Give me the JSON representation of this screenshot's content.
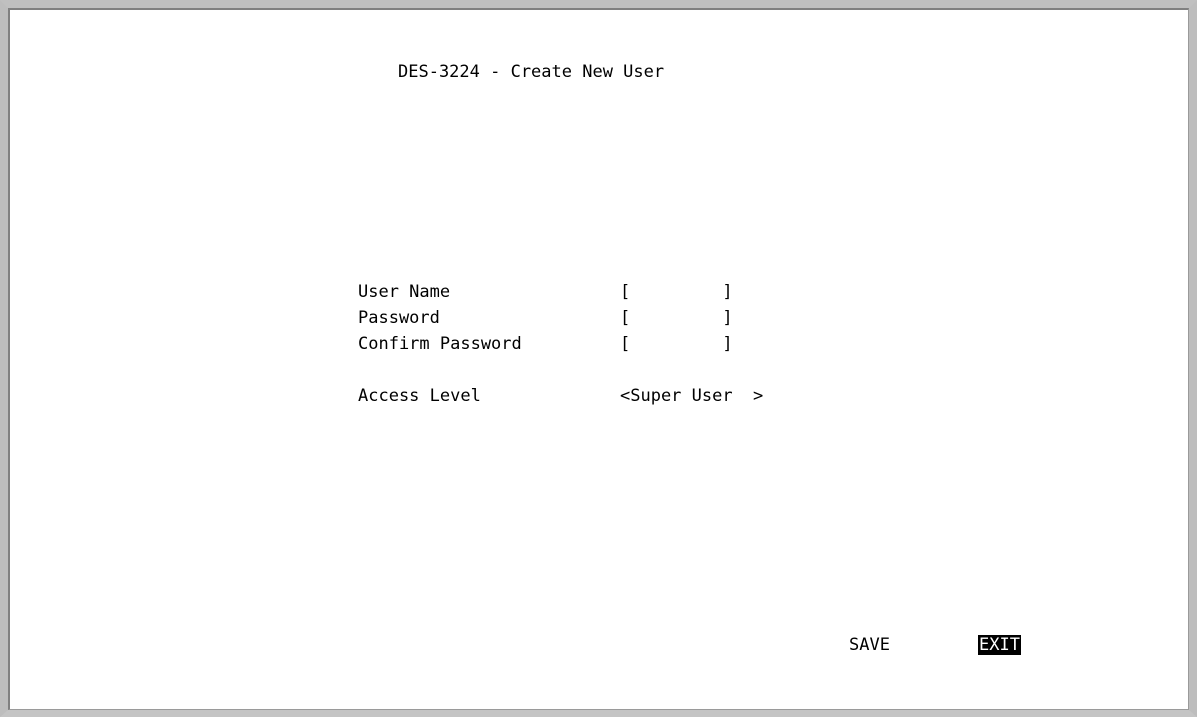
{
  "screen": {
    "title": "DES-3224 - Create New User"
  },
  "form": {
    "user_name": {
      "label": "User Name",
      "value": "[         ]"
    },
    "password": {
      "label": "Password",
      "value": "[         ]"
    },
    "confirm_password": {
      "label": "Confirm Password",
      "value": "[         ]"
    },
    "access_level": {
      "label": "Access Level",
      "value": "<Super User  >"
    }
  },
  "actions": {
    "save_label": "SAVE",
    "exit_label": "EXIT",
    "selected": "EXIT"
  },
  "colors": {
    "background": "#ffffff",
    "text": "#000000",
    "highlight_bg": "#000000",
    "highlight_text": "#ffffff",
    "frame": "#c0c0c0"
  }
}
